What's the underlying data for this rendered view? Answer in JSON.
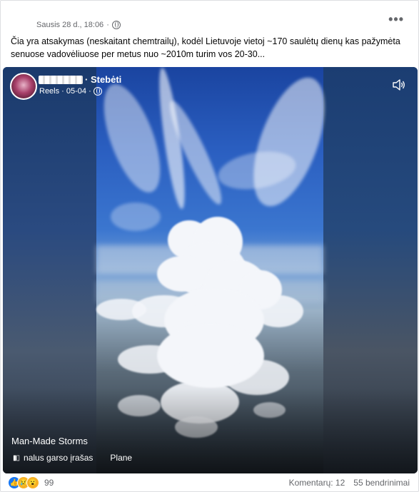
{
  "post": {
    "timestamp": "Sausis 28 d., 18:06",
    "separator": "·",
    "more_label": "•••",
    "text": "Čia yra atsakymas (neskaitant chemtrailų), kodėl Lietuvoje vietoj ~170 saulėtų dienų kas pažymėta senuose vadovėliuose  per metus nuo ~2010m turim vos 20-30..."
  },
  "video": {
    "follow_label": "· Stebėti",
    "reels_label": "Reels · 05-04 ·",
    "title": "Man-Made Storms",
    "audio_label": "nalus garso įrašas",
    "audio_place": "Plane",
    "speaker_icon": "speaker-icon"
  },
  "footer": {
    "reactions_count": "99",
    "comments": "Komentarų: 12",
    "shares": "55 bendrinimai",
    "reaction_icons": [
      "like-icon",
      "sad-icon",
      "wow-icon"
    ]
  }
}
